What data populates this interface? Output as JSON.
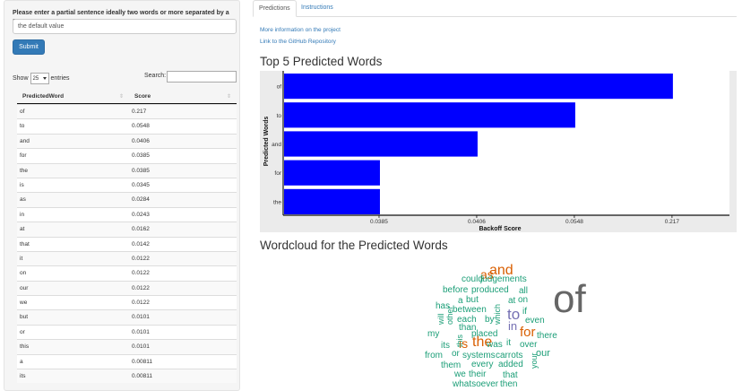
{
  "sidebar": {
    "prompt_label": "Please enter a partial sentence ideally two words or more separated by a space",
    "input_value": "the default value",
    "submit_label": "Submit",
    "show_label": "Show",
    "entries_value": "25",
    "entries_label": "entries",
    "search_label": "Search:"
  },
  "table": {
    "headers": [
      "PredictedWord",
      "Score"
    ],
    "rows": [
      [
        "of",
        "0.217"
      ],
      [
        "to",
        "0.0548"
      ],
      [
        "and",
        "0.0406"
      ],
      [
        "for",
        "0.0385"
      ],
      [
        "the",
        "0.0385"
      ],
      [
        "is",
        "0.0345"
      ],
      [
        "as",
        "0.0284"
      ],
      [
        "in",
        "0.0243"
      ],
      [
        "at",
        "0.0162"
      ],
      [
        "that",
        "0.0142"
      ],
      [
        "it",
        "0.0122"
      ],
      [
        "on",
        "0.0122"
      ],
      [
        "our",
        "0.0122"
      ],
      [
        "we",
        "0.0122"
      ],
      [
        "but",
        "0.0101"
      ],
      [
        "or",
        "0.0101"
      ],
      [
        "this",
        "0.0101"
      ],
      [
        "a",
        "0.00811"
      ],
      [
        "its",
        "0.00811"
      ]
    ]
  },
  "tabs": [
    "Predictions",
    "Instructions"
  ],
  "links": {
    "more_info": "More information on the project",
    "github": "Link to the GitHub Repository"
  },
  "titles": {
    "top5": "Top 5 Predicted Words",
    "cloud": "Wordcloud for the Predicted Words"
  },
  "chart_data": {
    "type": "bar",
    "orientation": "horizontal",
    "categories": [
      "of",
      "to",
      "and",
      "for",
      "the"
    ],
    "values": [
      0.217,
      0.0548,
      0.0406,
      0.0385,
      0.0385
    ],
    "tick_labels": [
      "0.0385",
      "0.0406",
      "0.0548",
      "0.217"
    ],
    "xlabel": "Backoff Score",
    "ylabel": "Predicted Words",
    "bar_color": "#0000ff"
  },
  "wordcloud": {
    "words": [
      {
        "text": "of",
        "color": "#666666"
      },
      {
        "text": "and",
        "color": "#d95f02"
      },
      {
        "text": "to",
        "color": "#7570b3"
      },
      {
        "text": "the",
        "color": "#d95f02"
      },
      {
        "text": "is",
        "color": "#d95f02"
      },
      {
        "text": "for",
        "color": "#d95f02"
      },
      {
        "text": "as",
        "color": "#d95f02"
      },
      {
        "text": "in",
        "color": "#7570b3"
      },
      {
        "text": "could",
        "color": "#1b9e77"
      },
      {
        "text": "judgements",
        "color": "#1b9e77"
      },
      {
        "text": "before",
        "color": "#1b9e77"
      },
      {
        "text": "produced",
        "color": "#1b9e77"
      },
      {
        "text": "all",
        "color": "#1b9e77"
      },
      {
        "text": "a",
        "color": "#1b9e77"
      },
      {
        "text": "but",
        "color": "#1b9e77"
      },
      {
        "text": "at",
        "color": "#1b9e77"
      },
      {
        "text": "on",
        "color": "#1b9e77"
      },
      {
        "text": "has",
        "color": "#1b9e77"
      },
      {
        "text": "between",
        "color": "#1b9e77"
      },
      {
        "text": "if",
        "color": "#1b9e77"
      },
      {
        "text": "will",
        "color": "#1b9e77"
      },
      {
        "text": "other",
        "color": "#1b9e77"
      },
      {
        "text": "each",
        "color": "#1b9e77"
      },
      {
        "text": "by",
        "color": "#1b9e77"
      },
      {
        "text": "which",
        "color": "#1b9e77"
      },
      {
        "text": "even",
        "color": "#1b9e77"
      },
      {
        "text": "than",
        "color": "#1b9e77"
      },
      {
        "text": "my",
        "color": "#1b9e77"
      },
      {
        "text": "this",
        "color": "#1b9e77"
      },
      {
        "text": "placed",
        "color": "#1b9e77"
      },
      {
        "text": "there",
        "color": "#1b9e77"
      },
      {
        "text": "its",
        "color": "#1b9e77"
      },
      {
        "text": "was",
        "color": "#1b9e77"
      },
      {
        "text": "it",
        "color": "#1b9e77"
      },
      {
        "text": "over",
        "color": "#1b9e77"
      },
      {
        "text": "from",
        "color": "#1b9e77"
      },
      {
        "text": "or",
        "color": "#1b9e77"
      },
      {
        "text": "systems",
        "color": "#1b9e77"
      },
      {
        "text": "carrots",
        "color": "#1b9e77"
      },
      {
        "text": "our",
        "color": "#1b9e77"
      },
      {
        "text": "them",
        "color": "#1b9e77"
      },
      {
        "text": "every",
        "color": "#1b9e77"
      },
      {
        "text": "added",
        "color": "#1b9e77"
      },
      {
        "text": "your",
        "color": "#1b9e77"
      },
      {
        "text": "we",
        "color": "#1b9e77"
      },
      {
        "text": "their",
        "color": "#1b9e77"
      },
      {
        "text": "that",
        "color": "#1b9e77"
      },
      {
        "text": "whatsoever",
        "color": "#1b9e77"
      },
      {
        "text": "then",
        "color": "#1b9e77"
      }
    ]
  }
}
